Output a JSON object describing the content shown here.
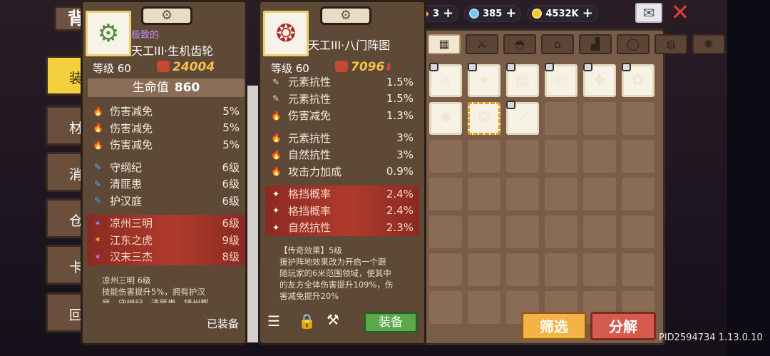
{
  "header": {
    "bag_title": "背包"
  },
  "topbar": [
    {
      "icon": "ticket-icon",
      "value": "3"
    },
    {
      "icon": "gem-icon",
      "value": "385"
    },
    {
      "icon": "coin-icon",
      "value": "4532K"
    }
  ],
  "side_tabs": [
    "装",
    "材",
    "消",
    "仓",
    "卡",
    "回"
  ],
  "filters": [
    "grid-all-icon",
    "sword-icon",
    "armor-icon",
    "helmet-icon",
    "boots-icon",
    "ring-icon",
    "bag-icon",
    "gear-icon"
  ],
  "inventory": {
    "items": [
      {
        "icon": "sword-item-icon",
        "glyph": "⚔",
        "locked": true,
        "selected": false
      },
      {
        "icon": "blue-gem-item-icon",
        "glyph": "✦",
        "locked": true,
        "selected": false
      },
      {
        "icon": "book-item-icon",
        "glyph": "▤",
        "locked": true,
        "selected": false
      },
      {
        "icon": "teal-ring-item-icon",
        "glyph": "◎",
        "locked": true,
        "selected": false
      },
      {
        "icon": "seal-item-icon",
        "glyph": "✚",
        "locked": true,
        "selected": false
      },
      {
        "icon": "vine-item-icon",
        "glyph": "✿",
        "locked": true,
        "selected": false
      },
      {
        "icon": "sun-emblem-item-icon",
        "glyph": "✹",
        "locked": false,
        "selected": false
      },
      {
        "icon": "formation-item-icon",
        "glyph": "❂",
        "locked": false,
        "selected": true
      },
      {
        "icon": "wand-item-icon",
        "glyph": "⟋",
        "locked": true,
        "selected": false
      }
    ],
    "total_cells": 42
  },
  "buttons": {
    "filter": "筛选",
    "decompose": "分解",
    "equip": "装备"
  },
  "pid": "PID2594734 1.13.0.10",
  "card1": {
    "rarity": "极致的",
    "name": "天工III·生机齿轮",
    "level": "等级 60",
    "power": "24004",
    "hp_label": "生命值",
    "hp_value": "860",
    "groups": [
      [
        {
          "label": "伤害减免",
          "value": "5%",
          "icon": "flame-icon",
          "glyph": "🔥",
          "color": "#f4a028",
          "red": false
        },
        {
          "label": "伤害减免",
          "value": "5%",
          "icon": "flame-icon",
          "glyph": "🔥",
          "color": "#f4a028",
          "red": false
        },
        {
          "label": "伤害减免",
          "value": "5%",
          "icon": "flame-icon",
          "glyph": "🔥",
          "color": "#f4a028",
          "red": false
        }
      ],
      [
        {
          "label": "守纲纪",
          "value": "6级",
          "icon": "blue-pen-icon",
          "glyph": "✎",
          "color": "#5aa9f2",
          "red": false
        },
        {
          "label": "清匪患",
          "value": "6级",
          "icon": "blue-pen-icon",
          "glyph": "✎",
          "color": "#5aa9f2",
          "red": false
        },
        {
          "label": "护汉庭",
          "value": "6级",
          "icon": "blue-pen-icon",
          "glyph": "✎",
          "color": "#5aa9f2",
          "red": false
        }
      ],
      [
        {
          "label": "凉州三明",
          "value": "6级",
          "icon": "blue-spark-icon",
          "glyph": "✶",
          "color": "#5aa9f2",
          "red": true
        },
        {
          "label": "江东之虎",
          "value": "9级",
          "icon": "gold-spark-icon",
          "glyph": "✶",
          "color": "#f4c430",
          "red": true
        },
        {
          "label": "汉末三杰",
          "value": "8级",
          "icon": "purple-spark-icon",
          "glyph": "✶",
          "color": "#b77cff",
          "red": true
        }
      ]
    ],
    "desc": [
      "凉州三明 6级",
      "技能伤害提升5%，拥有护汉",
      "庭、守纲纪、清匪患、镇州郡"
    ],
    "equipped": "已装备"
  },
  "card2": {
    "name": "天工III·八门阵图",
    "level": "等级 60",
    "power": "7096",
    "groups": [
      [
        {
          "label": "元素抗性",
          "value": "1.5%",
          "icon": "grey-pen-icon",
          "glyph": "✎",
          "color": "#d8d8d8",
          "red": false
        },
        {
          "label": "元素抗性",
          "value": "1.5%",
          "icon": "grey-pen-icon",
          "glyph": "✎",
          "color": "#d8d8d8",
          "red": false
        },
        {
          "label": "伤害减免",
          "value": "1.3%",
          "icon": "green-flame-icon",
          "glyph": "🔥",
          "color": "#58c94a",
          "red": false
        }
      ],
      [
        {
          "label": "元素抗性",
          "value": "3%",
          "icon": "green-flame-icon",
          "glyph": "🔥",
          "color": "#58c94a",
          "red": false
        },
        {
          "label": "自然抗性",
          "value": "3%",
          "icon": "green-flame-icon",
          "glyph": "🔥",
          "color": "#58c94a",
          "red": false
        },
        {
          "label": "攻击力加成",
          "value": "0.9%",
          "icon": "grey-flame-icon",
          "glyph": "🔥",
          "color": "#c9c9c9",
          "red": false
        }
      ],
      [
        {
          "label": "格挡概率",
          "value": "2.4%",
          "icon": "white-spark-icon",
          "glyph": "✦",
          "color": "#ffffff",
          "red": true
        },
        {
          "label": "格挡概率",
          "value": "2.4%",
          "icon": "white-spark-icon",
          "glyph": "✦",
          "color": "#ffffff",
          "red": true
        },
        {
          "label": "自然抗性",
          "value": "2.3%",
          "icon": "white-spark-icon",
          "glyph": "✦",
          "color": "#ffffff",
          "red": true
        }
      ]
    ],
    "desc": [
      "【传奇效果】5级",
      "援护阵地效果改为开启一个跟",
      "随玩家的6米范围领域，使其中",
      "的友方全体伤害提升109%，伤",
      "害减免提升20%"
    ]
  },
  "colors": {
    "panel": "#7a5d48",
    "card": "#5e4836",
    "accent_gold": "#f3c24a",
    "equip_green": "#5aa84a",
    "filter_orange": "#f5b347",
    "decompose_red": "#d65b4f"
  }
}
